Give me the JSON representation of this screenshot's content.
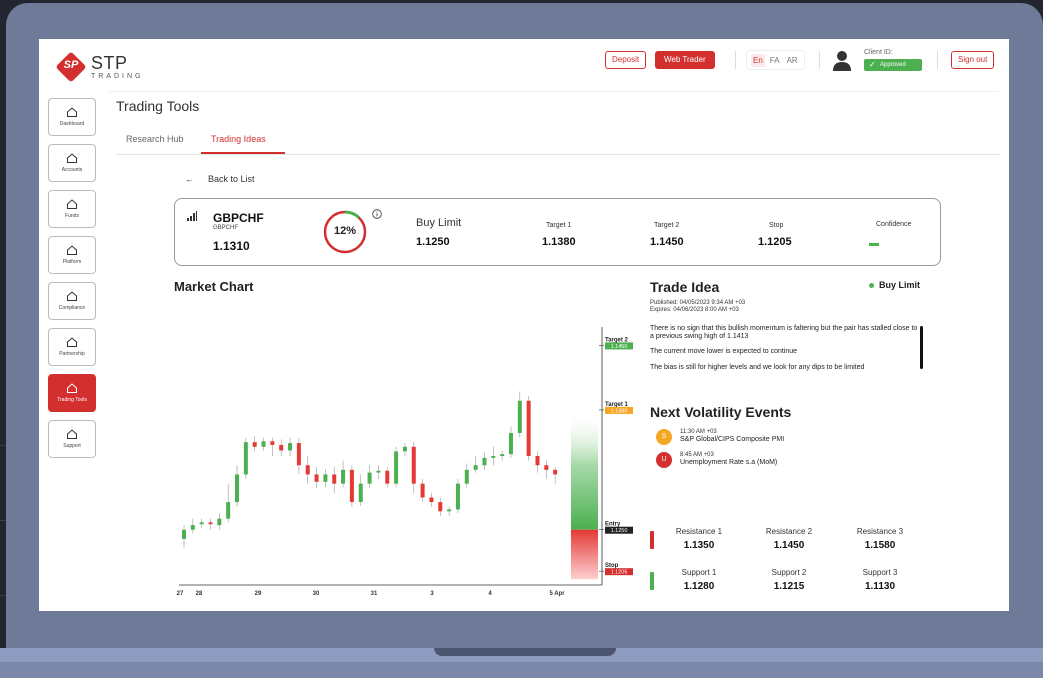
{
  "header": {
    "logo_main": "STP",
    "logo_sub": "TRADING",
    "logo_badge": "SP",
    "deposit_label": "Deposit",
    "webtrader_label": "Web Trader",
    "languages": [
      "En",
      "FA",
      "AR"
    ],
    "client_id_label": "Client ID:",
    "status_badge": "Approved",
    "signout_label": "Sign out"
  },
  "sidebar": {
    "items": [
      {
        "label": "Dashboard"
      },
      {
        "label": "Accounts"
      },
      {
        "label": "Funds"
      },
      {
        "label": "Platform"
      },
      {
        "label": "Compliance"
      },
      {
        "label": "Partnership"
      },
      {
        "label": "Trading Tools"
      },
      {
        "label": "Support"
      }
    ]
  },
  "page": {
    "title": "Trading Tools",
    "tabs": [
      "Research Hub",
      "Trading Ideas"
    ],
    "back_label": "Back to List"
  },
  "instrument": {
    "symbol": "GBPCHF",
    "symbol_sub": "GBPCHF",
    "price": "1.1310",
    "percent": "12%",
    "percent_value": 12,
    "buy_limit_label": "Buy Limit",
    "buy_limit": "1.1250",
    "target1_label": "Target 1",
    "target1": "1.1380",
    "target2_label": "Target 2",
    "target2": "1.1450",
    "stop_label": "Stop",
    "stop": "1.1205",
    "confidence_label": "Confidence"
  },
  "market_chart": {
    "title": "Market Chart"
  },
  "chart_data": {
    "type": "candlestick",
    "x_ticks": [
      "27",
      "28",
      "29",
      "30",
      "31",
      "3",
      "4",
      "5 Apr"
    ],
    "levels": [
      {
        "name": "Target 2",
        "value": "1.1450",
        "color": "#4caf50"
      },
      {
        "name": "Target 1",
        "value": "1.1380",
        "color": "#f5a623"
      },
      {
        "name": "Entry",
        "value": "1.1250",
        "color": "#222222"
      },
      {
        "name": "Stop",
        "value": "1.1205",
        "color": "#d32f2f"
      }
    ],
    "candles": [
      {
        "o": 1.124,
        "c": 1.125,
        "h": 1.1255,
        "l": 1.123
      },
      {
        "o": 1.125,
        "c": 1.1255,
        "h": 1.1262,
        "l": 1.1246
      },
      {
        "o": 1.1256,
        "c": 1.1258,
        "h": 1.1262,
        "l": 1.1252
      },
      {
        "o": 1.1258,
        "c": 1.1256,
        "h": 1.1262,
        "l": 1.125
      },
      {
        "o": 1.1255,
        "c": 1.1262,
        "h": 1.1268,
        "l": 1.125
      },
      {
        "o": 1.1262,
        "c": 1.128,
        "h": 1.13,
        "l": 1.1258
      },
      {
        "o": 1.128,
        "c": 1.131,
        "h": 1.132,
        "l": 1.1275
      },
      {
        "o": 1.131,
        "c": 1.1345,
        "h": 1.135,
        "l": 1.1305
      },
      {
        "o": 1.1345,
        "c": 1.134,
        "h": 1.1352,
        "l": 1.1335
      },
      {
        "o": 1.134,
        "c": 1.1346,
        "h": 1.135,
        "l": 1.1336
      },
      {
        "o": 1.1346,
        "c": 1.1342,
        "h": 1.135,
        "l": 1.133
      },
      {
        "o": 1.1342,
        "c": 1.1336,
        "h": 1.1348,
        "l": 1.133
      },
      {
        "o": 1.1336,
        "c": 1.1344,
        "h": 1.135,
        "l": 1.133
      },
      {
        "o": 1.1344,
        "c": 1.132,
        "h": 1.135,
        "l": 1.131
      },
      {
        "o": 1.132,
        "c": 1.131,
        "h": 1.133,
        "l": 1.13
      },
      {
        "o": 1.131,
        "c": 1.1302,
        "h": 1.1318,
        "l": 1.1295
      },
      {
        "o": 1.1302,
        "c": 1.131,
        "h": 1.1316,
        "l": 1.1296
      },
      {
        "o": 1.131,
        "c": 1.13,
        "h": 1.1318,
        "l": 1.129
      },
      {
        "o": 1.13,
        "c": 1.1315,
        "h": 1.1325,
        "l": 1.1296
      },
      {
        "o": 1.1315,
        "c": 1.128,
        "h": 1.132,
        "l": 1.1275
      },
      {
        "o": 1.128,
        "c": 1.13,
        "h": 1.131,
        "l": 1.1276
      },
      {
        "o": 1.13,
        "c": 1.1312,
        "h": 1.132,
        "l": 1.1296
      },
      {
        "o": 1.1312,
        "c": 1.1314,
        "h": 1.132,
        "l": 1.1305
      },
      {
        "o": 1.1314,
        "c": 1.13,
        "h": 1.1318,
        "l": 1.1296
      },
      {
        "o": 1.13,
        "c": 1.1335,
        "h": 1.134,
        "l": 1.1296
      },
      {
        "o": 1.1335,
        "c": 1.134,
        "h": 1.1344,
        "l": 1.133
      },
      {
        "o": 1.134,
        "c": 1.13,
        "h": 1.1345,
        "l": 1.129
      },
      {
        "o": 1.13,
        "c": 1.1285,
        "h": 1.1305,
        "l": 1.128
      },
      {
        "o": 1.1285,
        "c": 1.128,
        "h": 1.129,
        "l": 1.1275
      },
      {
        "o": 1.128,
        "c": 1.127,
        "h": 1.1285,
        "l": 1.1265
      },
      {
        "o": 1.127,
        "c": 1.1272,
        "h": 1.1275,
        "l": 1.1265
      },
      {
        "o": 1.1272,
        "c": 1.13,
        "h": 1.1305,
        "l": 1.1268
      },
      {
        "o": 1.13,
        "c": 1.1315,
        "h": 1.1322,
        "l": 1.1296
      },
      {
        "o": 1.1315,
        "c": 1.132,
        "h": 1.133,
        "l": 1.1312
      },
      {
        "o": 1.132,
        "c": 1.1328,
        "h": 1.1334,
        "l": 1.1315
      },
      {
        "o": 1.1328,
        "c": 1.133,
        "h": 1.134,
        "l": 1.132
      },
      {
        "o": 1.133,
        "c": 1.1332,
        "h": 1.1336,
        "l": 1.1325
      },
      {
        "o": 1.1332,
        "c": 1.1355,
        "h": 1.1362,
        "l": 1.1328
      },
      {
        "o": 1.1355,
        "c": 1.139,
        "h": 1.14,
        "l": 1.135
      },
      {
        "o": 1.139,
        "c": 1.133,
        "h": 1.1395,
        "l": 1.1325
      },
      {
        "o": 1.133,
        "c": 1.132,
        "h": 1.1335,
        "l": 1.1312
      },
      {
        "o": 1.132,
        "c": 1.1315,
        "h": 1.1325,
        "l": 1.1305
      },
      {
        "o": 1.1315,
        "c": 1.131,
        "h": 1.1318,
        "l": 1.13
      }
    ],
    "ylim": [
      1.119,
      1.147
    ]
  },
  "trade_idea": {
    "title": "Trade Idea",
    "status": "Buy Limit",
    "published": "Published: 04/05/2023 9:34 AM +03",
    "expires": "Expires: 04/06/2023 8:00 AM +03",
    "paragraphs": [
      "There is no sign that this bullish momentum is faltering but the pair has stalled close to a previous swing high of 1.1413",
      "The current move lower is expected to continue",
      "The bias is still for higher levels and we look for any dips to be limited"
    ]
  },
  "volatility": {
    "title": "Next Volatility Events",
    "events": [
      {
        "badge": "S",
        "time": "11:30 AM +03",
        "name": "S&P Global/CIPS Composite PMI",
        "color": "#f5a623"
      },
      {
        "badge": "U",
        "time": "8:45 AM +03",
        "name": "Unemployment Rate s.a (MoM)",
        "color": "#d32f2f"
      }
    ]
  },
  "levels": {
    "resistance": [
      {
        "label": "Resistance 1",
        "value": "1.1350"
      },
      {
        "label": "Resistance 2",
        "value": "1.1450"
      },
      {
        "label": "Resistance 3",
        "value": "1.1580"
      }
    ],
    "support": [
      {
        "label": "Support 1",
        "value": "1.1280"
      },
      {
        "label": "Support 2",
        "value": "1.1215"
      },
      {
        "label": "Support 3",
        "value": "1.1130"
      }
    ]
  }
}
